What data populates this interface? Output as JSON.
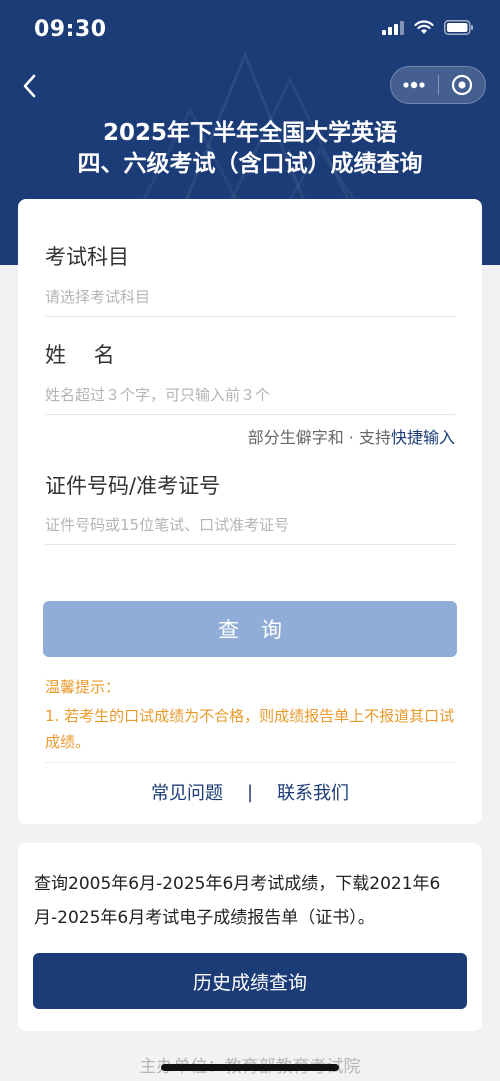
{
  "status_bar": {
    "time": "09:30"
  },
  "header": {
    "title_line1": "2025年下半年全国大学英语",
    "title_line2": "四、六级考试（含口试）成绩查询"
  },
  "form": {
    "subject_label": "考试科目",
    "subject_placeholder": "请选择考试科目",
    "name_label": "姓　 名",
    "name_placeholder": "姓名超过３个字，可只输入前３个",
    "rare_char_hint": "部分生僻字和 · 支持",
    "rare_char_link": "快捷输入",
    "id_label": "证件号码/准考证号",
    "id_placeholder": "证件号码或15位笔试、口试准考证号",
    "query_button": "查询"
  },
  "tips": {
    "title": "温馨提示：",
    "body": "1. 若考生的口试成绩为不合格，则成绩报告单上不报道其口试成绩。"
  },
  "links": {
    "faq": "常见问题",
    "separator": "|",
    "contact": "联系我们"
  },
  "history": {
    "description": "查询2005年6月-2025年6月考试成绩，下载2021年6月-2025年6月考试电子成绩报告单（证书）。",
    "button": "历史成绩查询"
  },
  "footer": {
    "organizer": "主办单位：教育部教育考试院"
  },
  "colors": {
    "brand": "#1c3c78",
    "button_disabled": "#8fadd6",
    "tip": "#e99a2d",
    "background": "#f2f2f4"
  },
  "icons": [
    "back-icon",
    "more-dots-icon",
    "target-icon",
    "signal-icon",
    "wifi-icon",
    "battery-icon"
  ]
}
